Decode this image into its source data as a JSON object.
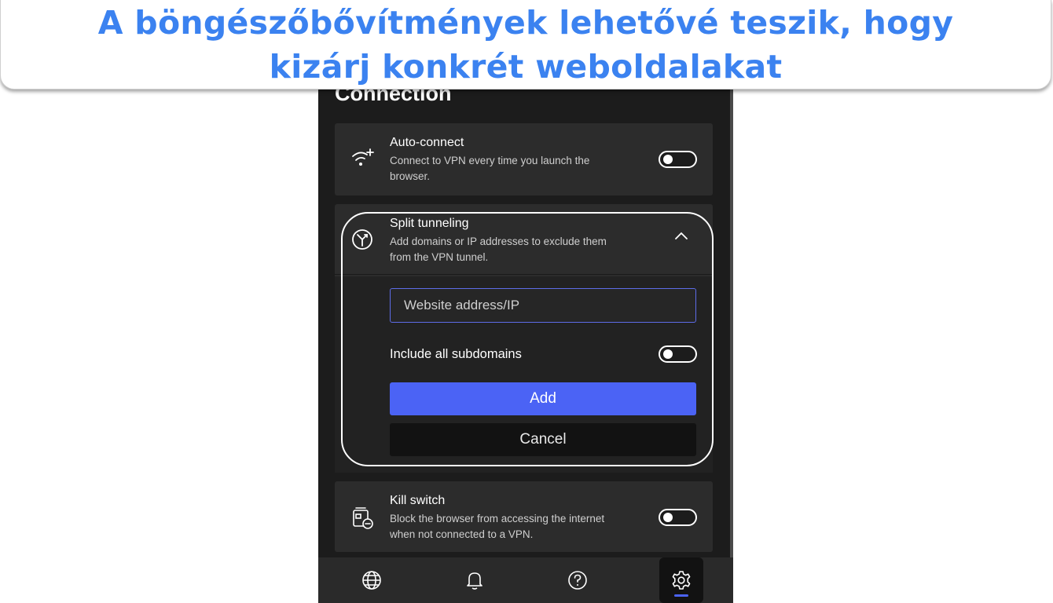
{
  "caption": {
    "text": "A böngészőbővítmények lehetővé teszik, hogy kizárj konkrét weboldalakat"
  },
  "panel": {
    "section_title": "Connection",
    "auto_connect": {
      "title": "Auto-connect",
      "description": "Connect to VPN every time you launch the browser.",
      "icon": "wifi-sparkle-icon",
      "enabled": false
    },
    "split_tunneling": {
      "title": "Split tunneling",
      "description": "Add domains or IP addresses to exclude them from the VPN tunnel.",
      "icon": "split-tunnel-icon",
      "expanded": true,
      "input_placeholder": "Website address/IP",
      "include_subdomains_label": "Include all subdomains",
      "include_subdomains_enabled": false,
      "add_label": "Add",
      "cancel_label": "Cancel"
    },
    "kill_switch": {
      "title": "Kill switch",
      "description": "Block the browser from accessing the internet when not connected to a VPN.",
      "icon": "kill-switch-icon",
      "enabled": false
    }
  },
  "bottom_nav": {
    "items": [
      {
        "icon": "globe-icon",
        "active": false
      },
      {
        "icon": "bell-icon",
        "active": false
      },
      {
        "icon": "help-icon",
        "active": false
      },
      {
        "icon": "gear-icon",
        "active": true
      }
    ]
  },
  "colors": {
    "caption_text": "#3b82f0",
    "panel_bg": "#1c1c1c",
    "card_bg": "#2c2c2c",
    "accent": "#4b63f5"
  }
}
